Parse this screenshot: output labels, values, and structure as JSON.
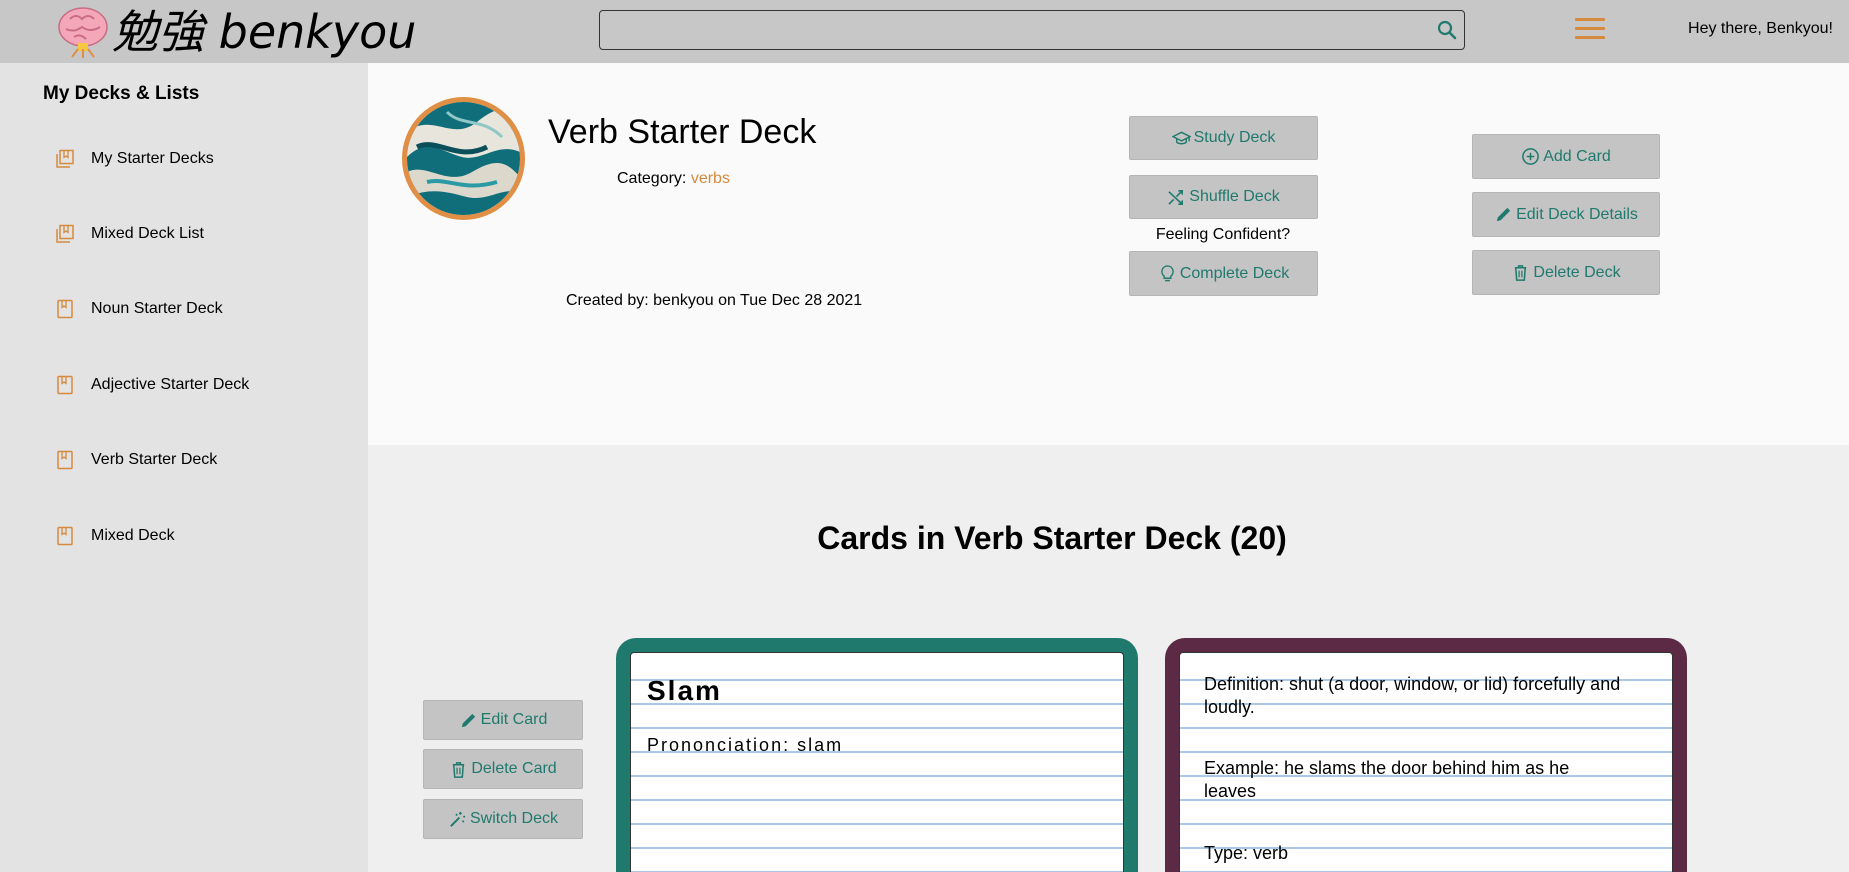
{
  "header": {
    "logo_text": "勉強 benkyou",
    "search_placeholder": "",
    "greeting": "Hey there, Benkyou!"
  },
  "colors": {
    "accent_orange": "#d68a3e",
    "accent_teal": "#1f7a6d",
    "card_front_border": "#1f7a6d",
    "card_back_border": "#5c2a44"
  },
  "sidebar": {
    "title": "My Decks & Lists",
    "items": [
      {
        "label": "My Starter Decks",
        "icon": "deck-list-icon"
      },
      {
        "label": "Mixed Deck List",
        "icon": "deck-list-icon"
      },
      {
        "label": "Noun Starter Deck",
        "icon": "bookmark-book-icon"
      },
      {
        "label": "Adjective Starter Deck",
        "icon": "bookmark-book-icon"
      },
      {
        "label": "Verb Starter Deck",
        "icon": "bookmark-book-icon"
      },
      {
        "label": "Mixed Deck",
        "icon": "bookmark-book-icon"
      }
    ]
  },
  "deck": {
    "title": "Verb Starter Deck",
    "category_label": "Category:",
    "category_value": "verbs",
    "created_by": "Created by: benkyou on Tue Dec 28 2021",
    "actions": {
      "study": "Study Deck",
      "shuffle": "Shuffle Deck",
      "confident_prompt": "Feeling Confident?",
      "complete": "Complete Deck",
      "add_card": "Add Card",
      "edit_details": "Edit Deck Details",
      "delete_deck": "Delete Deck"
    }
  },
  "cards_section": {
    "title": "Cards in Verb Starter Deck (20)",
    "card_actions": {
      "edit": "Edit Card",
      "delete": "Delete Card",
      "switch": "Switch Deck"
    },
    "card": {
      "word": "Slam",
      "pronunciation": "Prononciation: slam",
      "definition": "Definition: shut (a door, window, or lid) forcefully and loudly.",
      "example": "Example: he slams the door behind him as he leaves",
      "type": "Type: verb"
    }
  }
}
